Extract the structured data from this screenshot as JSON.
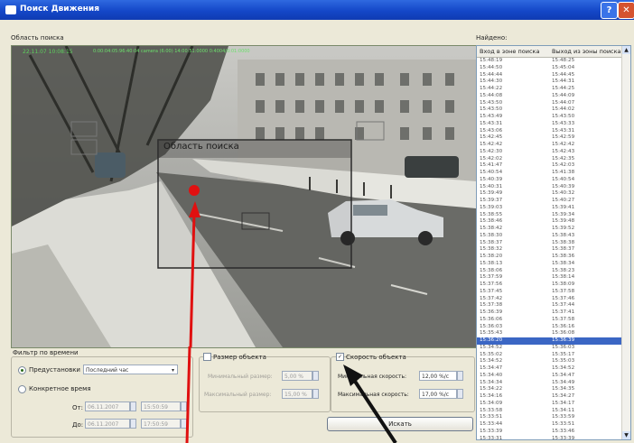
{
  "window": {
    "title": "Поиск Движения"
  },
  "labels": {
    "search_area": "Область поиска",
    "found": "Найдено:",
    "search_zone_overlay": "Область поиска",
    "osd_top": "22.11.07 10:08:15",
    "osd_mid": "0:00:04:05:96:40:04 camera (6:00) 14:00:51:0000 0:4004/0:01:0000"
  },
  "results": {
    "col_enter": "Вход в зоне поиска",
    "col_exit": "Выход из зоны поиска",
    "selected_index": 40,
    "rows": [
      [
        "15:48:19",
        "15:48:25"
      ],
      [
        "15:44:50",
        "15:45:04"
      ],
      [
        "15:44:44",
        "15:44:45"
      ],
      [
        "15:44:30",
        "15:44:31"
      ],
      [
        "15:44:22",
        "15:44:25"
      ],
      [
        "15:44:08",
        "15:44:09"
      ],
      [
        "15:43:50",
        "15:44:07"
      ],
      [
        "15:43:50",
        "15:44:02"
      ],
      [
        "15:43:49",
        "15:43:50"
      ],
      [
        "15:43:31",
        "15:43:33"
      ],
      [
        "15:43:06",
        "15:43:31"
      ],
      [
        "15:42:45",
        "15:42:59"
      ],
      [
        "15:42:42",
        "15:42:42"
      ],
      [
        "15:42:30",
        "15:42:43"
      ],
      [
        "15:42:02",
        "15:42:35"
      ],
      [
        "15:41:47",
        "15:42:03"
      ],
      [
        "15:40:54",
        "15:41:38"
      ],
      [
        "15:40:39",
        "15:40:54"
      ],
      [
        "15:40:31",
        "15:40:39"
      ],
      [
        "15:39:49",
        "15:40:32"
      ],
      [
        "15:39:37",
        "15:40:27"
      ],
      [
        "15:39:03",
        "15:39:41"
      ],
      [
        "15:38:55",
        "15:39:34"
      ],
      [
        "15:38:46",
        "15:39:48"
      ],
      [
        "15:38:42",
        "15:39:52"
      ],
      [
        "15:38:30",
        "15:38:43"
      ],
      [
        "15:38:37",
        "15:38:38"
      ],
      [
        "15:38:32",
        "15:38:37"
      ],
      [
        "15:38:20",
        "15:38:36"
      ],
      [
        "15:38:13",
        "15:38:34"
      ],
      [
        "15:38:06",
        "15:38:23"
      ],
      [
        "15:37:59",
        "15:38:14"
      ],
      [
        "15:37:56",
        "15:38:09"
      ],
      [
        "15:37:45",
        "15:37:58"
      ],
      [
        "15:37:42",
        "15:37:46"
      ],
      [
        "15:37:38",
        "15:37:44"
      ],
      [
        "15:36:39",
        "15:37:41"
      ],
      [
        "15:36:06",
        "15:37:58"
      ],
      [
        "15:36:03",
        "15:36:16"
      ],
      [
        "15:35:43",
        "15:36:08"
      ],
      [
        "15:36:20",
        "15:36:39"
      ],
      [
        "15:34:52",
        "15:36:03"
      ],
      [
        "15:35:02",
        "15:35:17"
      ],
      [
        "15:34:52",
        "15:35:03"
      ],
      [
        "15:34:47",
        "15:34:52"
      ],
      [
        "15:34:40",
        "15:34:47"
      ],
      [
        "15:34:34",
        "15:34:49"
      ],
      [
        "15:34:22",
        "15:34:35"
      ],
      [
        "15:34:16",
        "15:34:27"
      ],
      [
        "15:34:09",
        "15:34:17"
      ],
      [
        "15:33:58",
        "15:34:11"
      ],
      [
        "15:33:51",
        "15:33:59"
      ],
      [
        "15:33:44",
        "15:33:51"
      ],
      [
        "15:33:39",
        "15:33:46"
      ],
      [
        "15:33:31",
        "15:33:39"
      ]
    ]
  },
  "filter_time": {
    "title": "Фильтр по времени",
    "preset_label": "Предустановки",
    "preset_value": "Последний час",
    "specific_label": "Конкретное время",
    "from_label": "От:",
    "from_date": "06.11.2007",
    "from_time": "15:50:59",
    "to_label": "До:",
    "to_date": "06.11.2007",
    "to_time": "17:50:59"
  },
  "filter_size": {
    "title": "Размер объекта",
    "min_label": "Минимальный размер:",
    "min_value": "5,00 %",
    "max_label": "Максимальный размер:",
    "max_value": "15,00 %"
  },
  "filter_speed": {
    "title": "Скорость объекта",
    "checked": "✓",
    "min_label": "Минимальная скорость:",
    "min_value": "12,00 %/с",
    "max_label": "Максимальная скорость:",
    "max_value": "17,00 %/с"
  },
  "search_button": "Искать",
  "icons": {
    "close": "✕",
    "help": "?",
    "up": "▲",
    "down": "▼",
    "dropdown": "▾"
  },
  "colors": {
    "accent": "#3b66c4",
    "marker": "#e01010"
  }
}
